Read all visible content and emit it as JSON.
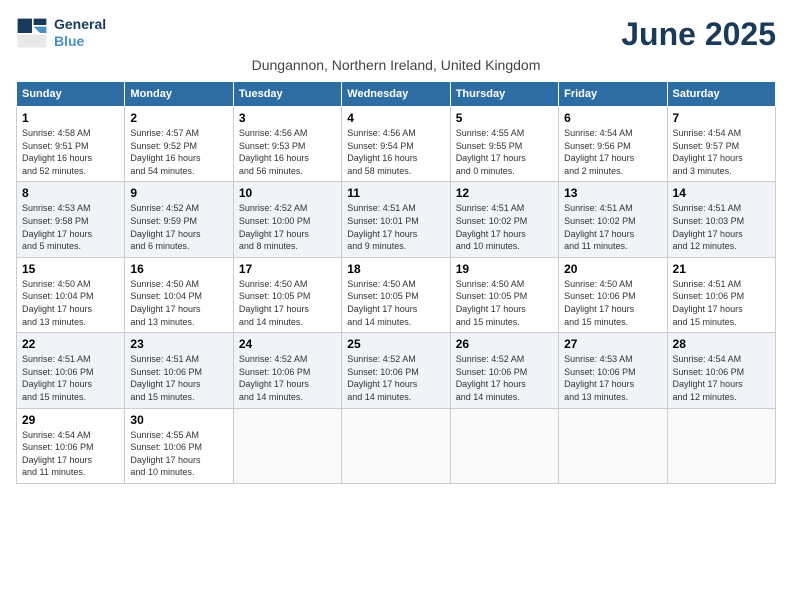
{
  "header": {
    "logo_line1": "General",
    "logo_line2": "Blue",
    "title": "June 2025",
    "subtitle": "Dungannon, Northern Ireland, United Kingdom"
  },
  "weekdays": [
    "Sunday",
    "Monday",
    "Tuesday",
    "Wednesday",
    "Thursday",
    "Friday",
    "Saturday"
  ],
  "weeks": [
    [
      {
        "day": "1",
        "sunrise": "4:58 AM",
        "sunset": "9:51 PM",
        "daylight": "16 hours and 52 minutes."
      },
      {
        "day": "2",
        "sunrise": "4:57 AM",
        "sunset": "9:52 PM",
        "daylight": "16 hours and 54 minutes."
      },
      {
        "day": "3",
        "sunrise": "4:56 AM",
        "sunset": "9:53 PM",
        "daylight": "16 hours and 56 minutes."
      },
      {
        "day": "4",
        "sunrise": "4:56 AM",
        "sunset": "9:54 PM",
        "daylight": "16 hours and 58 minutes."
      },
      {
        "day": "5",
        "sunrise": "4:55 AM",
        "sunset": "9:55 PM",
        "daylight": "17 hours and 0 minutes."
      },
      {
        "day": "6",
        "sunrise": "4:54 AM",
        "sunset": "9:56 PM",
        "daylight": "17 hours and 2 minutes."
      },
      {
        "day": "7",
        "sunrise": "4:54 AM",
        "sunset": "9:57 PM",
        "daylight": "17 hours and 3 minutes."
      }
    ],
    [
      {
        "day": "8",
        "sunrise": "4:53 AM",
        "sunset": "9:58 PM",
        "daylight": "17 hours and 5 minutes."
      },
      {
        "day": "9",
        "sunrise": "4:52 AM",
        "sunset": "9:59 PM",
        "daylight": "17 hours and 6 minutes."
      },
      {
        "day": "10",
        "sunrise": "4:52 AM",
        "sunset": "10:00 PM",
        "daylight": "17 hours and 8 minutes."
      },
      {
        "day": "11",
        "sunrise": "4:51 AM",
        "sunset": "10:01 PM",
        "daylight": "17 hours and 9 minutes."
      },
      {
        "day": "12",
        "sunrise": "4:51 AM",
        "sunset": "10:02 PM",
        "daylight": "17 hours and 10 minutes."
      },
      {
        "day": "13",
        "sunrise": "4:51 AM",
        "sunset": "10:02 PM",
        "daylight": "17 hours and 11 minutes."
      },
      {
        "day": "14",
        "sunrise": "4:51 AM",
        "sunset": "10:03 PM",
        "daylight": "17 hours and 12 minutes."
      }
    ],
    [
      {
        "day": "15",
        "sunrise": "4:50 AM",
        "sunset": "10:04 PM",
        "daylight": "17 hours and 13 minutes."
      },
      {
        "day": "16",
        "sunrise": "4:50 AM",
        "sunset": "10:04 PM",
        "daylight": "17 hours and 13 minutes."
      },
      {
        "day": "17",
        "sunrise": "4:50 AM",
        "sunset": "10:05 PM",
        "daylight": "17 hours and 14 minutes."
      },
      {
        "day": "18",
        "sunrise": "4:50 AM",
        "sunset": "10:05 PM",
        "daylight": "17 hours and 14 minutes."
      },
      {
        "day": "19",
        "sunrise": "4:50 AM",
        "sunset": "10:05 PM",
        "daylight": "17 hours and 15 minutes."
      },
      {
        "day": "20",
        "sunrise": "4:50 AM",
        "sunset": "10:06 PM",
        "daylight": "17 hours and 15 minutes."
      },
      {
        "day": "21",
        "sunrise": "4:51 AM",
        "sunset": "10:06 PM",
        "daylight": "17 hours and 15 minutes."
      }
    ],
    [
      {
        "day": "22",
        "sunrise": "4:51 AM",
        "sunset": "10:06 PM",
        "daylight": "17 hours and 15 minutes."
      },
      {
        "day": "23",
        "sunrise": "4:51 AM",
        "sunset": "10:06 PM",
        "daylight": "17 hours and 15 minutes."
      },
      {
        "day": "24",
        "sunrise": "4:52 AM",
        "sunset": "10:06 PM",
        "daylight": "17 hours and 14 minutes."
      },
      {
        "day": "25",
        "sunrise": "4:52 AM",
        "sunset": "10:06 PM",
        "daylight": "17 hours and 14 minutes."
      },
      {
        "day": "26",
        "sunrise": "4:52 AM",
        "sunset": "10:06 PM",
        "daylight": "17 hours and 14 minutes."
      },
      {
        "day": "27",
        "sunrise": "4:53 AM",
        "sunset": "10:06 PM",
        "daylight": "17 hours and 13 minutes."
      },
      {
        "day": "28",
        "sunrise": "4:54 AM",
        "sunset": "10:06 PM",
        "daylight": "17 hours and 12 minutes."
      }
    ],
    [
      {
        "day": "29",
        "sunrise": "4:54 AM",
        "sunset": "10:06 PM",
        "daylight": "17 hours and 11 minutes."
      },
      {
        "day": "30",
        "sunrise": "4:55 AM",
        "sunset": "10:06 PM",
        "daylight": "17 hours and 10 minutes."
      },
      {
        "day": "",
        "sunrise": "",
        "sunset": "",
        "daylight": ""
      },
      {
        "day": "",
        "sunrise": "",
        "sunset": "",
        "daylight": ""
      },
      {
        "day": "",
        "sunrise": "",
        "sunset": "",
        "daylight": ""
      },
      {
        "day": "",
        "sunrise": "",
        "sunset": "",
        "daylight": ""
      },
      {
        "day": "",
        "sunrise": "",
        "sunset": "",
        "daylight": ""
      }
    ]
  ]
}
